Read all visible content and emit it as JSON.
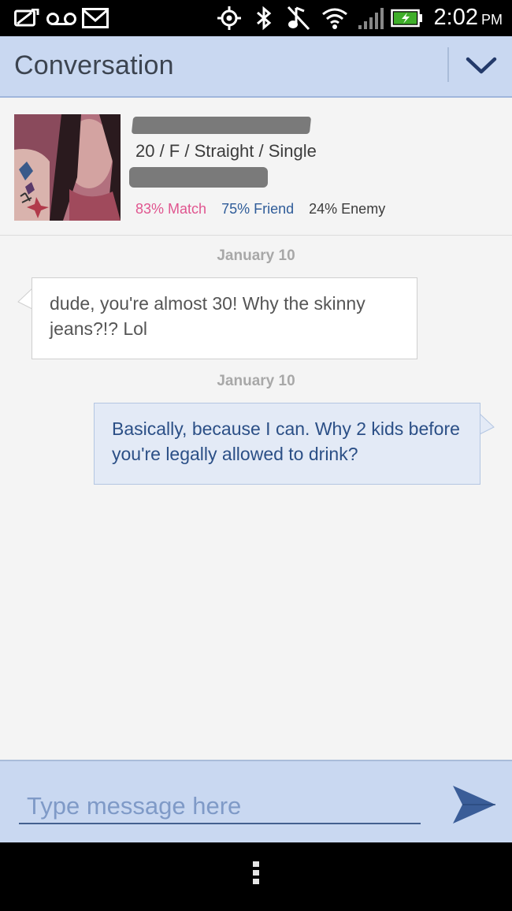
{
  "status_bar": {
    "time": "2:02",
    "ampm": "PM",
    "icons": [
      "no-sim-icon",
      "voicemail-icon",
      "gmail-icon",
      "gps-icon",
      "bluetooth-icon",
      "no-sound-icon",
      "wifi-icon",
      "signal-icon",
      "battery-charging-icon"
    ]
  },
  "header": {
    "title": "Conversation",
    "menu_icon": "chevron-down-icon"
  },
  "profile": {
    "details": "20 / F / Straight / Single",
    "match": "83% Match",
    "friend": "75% Friend",
    "enemy": "24% Enemy",
    "colors": {
      "match": "#e0558f",
      "friend": "#2f5c99",
      "enemy": "#3c3c3c"
    }
  },
  "messages": [
    {
      "date": "January 10",
      "direction": "incoming",
      "text": "dude, you're almost 30! Why the skinny jeans?!? Lol"
    },
    {
      "date": "January 10",
      "direction": "outgoing",
      "text": "Basically, because I can. Why 2 kids before you're legally allowed to drink?"
    }
  ],
  "composer": {
    "placeholder": "Type message here",
    "value": "",
    "send_icon": "send-icon"
  },
  "nav": {
    "menu_icon": "overflow-menu-icon"
  },
  "theme": {
    "header_bg": "#c9d8f1",
    "content_bg": "#f4f4f4",
    "outgoing_bubble_bg": "#e3eaf6",
    "accent": "#2b4f86"
  }
}
